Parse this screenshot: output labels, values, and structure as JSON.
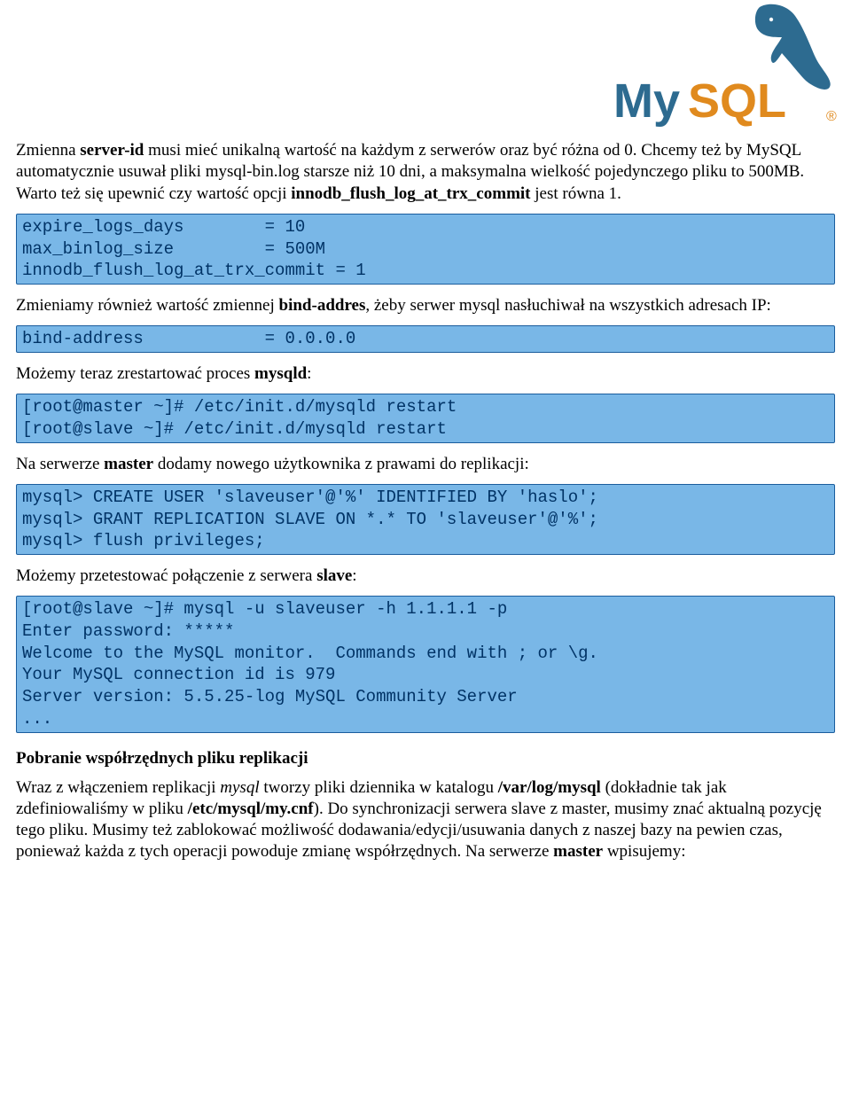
{
  "logo": {
    "name": "MySQL",
    "reg": "®"
  },
  "paragraphs": {
    "p1a": "Zmienna ",
    "p1b": "server-id",
    "p1c": " musi mieć unikalną wartość na każdym z serwerów oraz być różna od 0. Chcemy też by MySQL automatycznie usuwał pliki mysql-bin.log starsze niż 10 dni, a maksymalna wielkość pojedynczego pliku to 500MB. Warto też się upewnić czy wartość opcji ",
    "p1d": "innodb_flush_log_at_trx_commit",
    "p1e": " jest równa 1.",
    "p2a": "Zmieniamy również wartość zmiennej ",
    "p2b": "bind-addres",
    "p2c": ", żeby serwer mysql nasłuchiwał na wszystkich adresach IP:",
    "p3a": "Możemy teraz zrestartować proces ",
    "p3b": "mysqld",
    "p3c": ":",
    "p4a": "Na serwerze ",
    "p4b": "master",
    "p4c": " dodamy nowego użytkownika z prawami do replikacji:",
    "p5a": "Możemy przetestować połączenie z serwera ",
    "p5b": "slave",
    "p5c": ":",
    "h1": "Pobranie współrzędnych pliku replikacji",
    "p6a": "Wraz z włączeniem replikacji ",
    "p6b": "mysql",
    "p6c": " tworzy pliki dziennika w katalogu ",
    "p6d": "/var/log/mysql",
    "p6e": " (dokładnie tak jak zdefiniowaliśmy w pliku ",
    "p6f": "/etc/mysql/my.cnf",
    "p6g": "). Do synchronizacji serwera slave z master, musimy znać aktualną pozycję tego pliku. Musimy też zablokować możliwość dodawania/edycji/usuwania danych z naszej bazy na pewien czas, ponieważ każda z tych operacji powoduje zmianę współrzędnych. Na serwerze ",
    "p6h": "master",
    "p6i": " wpisujemy:"
  },
  "code": {
    "c1": "expire_logs_days        = 10\nmax_binlog_size         = 500M\ninnodb_flush_log_at_trx_commit = 1",
    "c2": "bind-address            = 0.0.0.0",
    "c3": "[root@master ~]# /etc/init.d/mysqld restart\n[root@slave ~]# /etc/init.d/mysqld restart",
    "c4": "mysql> CREATE USER 'slaveuser'@'%' IDENTIFIED BY 'haslo';\nmysql> GRANT REPLICATION SLAVE ON *.* TO 'slaveuser'@'%';\nmysql> flush privileges;",
    "c5": "[root@slave ~]# mysql -u slaveuser -h 1.1.1.1 -p\nEnter password: *****\nWelcome to the MySQL monitor.  Commands end with ; or \\g.\nYour MySQL connection id is 979\nServer version: 5.5.25-log MySQL Community Server\n..."
  }
}
